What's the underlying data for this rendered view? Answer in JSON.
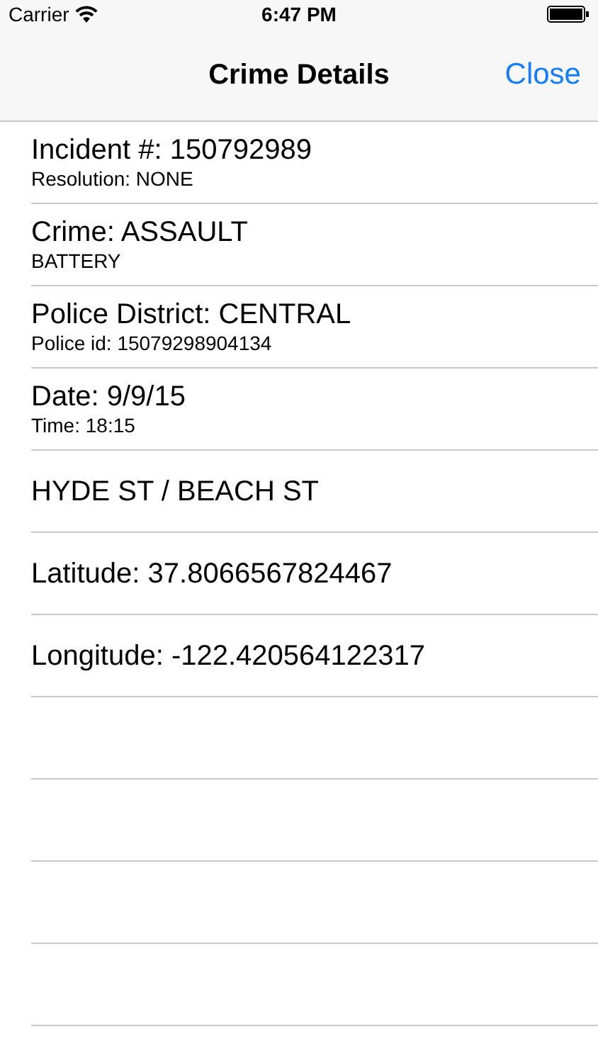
{
  "status_bar": {
    "carrier": "Carrier",
    "time": "6:47 PM"
  },
  "nav_bar": {
    "title": "Crime Details",
    "close": "Close"
  },
  "rows": [
    {
      "title": "Incident #: 150792989",
      "subtitle": "Resolution: NONE"
    },
    {
      "title": "Crime: ASSAULT",
      "subtitle": "BATTERY"
    },
    {
      "title": "Police District: CENTRAL",
      "subtitle": "Police id: 15079298904134"
    },
    {
      "title": "Date: 9/9/15",
      "subtitle": "Time: 18:15"
    },
    {
      "title": "HYDE ST / BEACH ST"
    },
    {
      "title": "Latitude: 37.8066567824467"
    },
    {
      "title": "Longitude: -122.420564122317"
    }
  ]
}
